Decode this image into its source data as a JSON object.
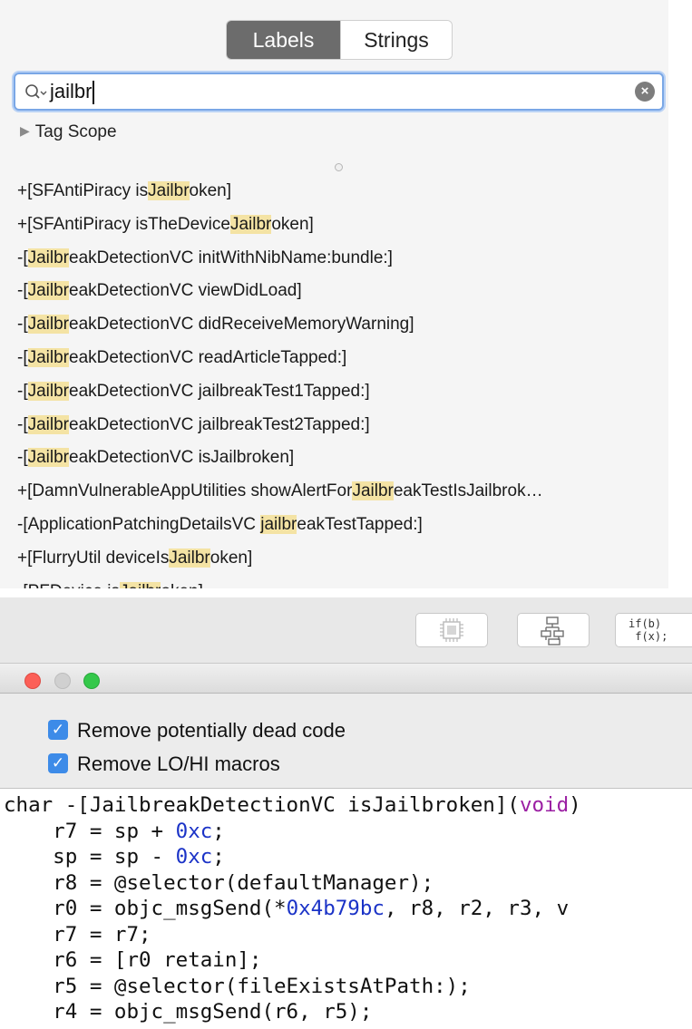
{
  "search_panel": {
    "tabs": [
      {
        "label": "Labels",
        "selected": true
      },
      {
        "label": "Strings",
        "selected": false
      }
    ],
    "search": {
      "prefix_icon": "search-icon",
      "value": "jailbr"
    },
    "tag_scope_label": "Tag Scope",
    "query_highlight": "jailbr",
    "results": [
      [
        "+[SFAntiPiracy is",
        {
          "h": "Jailbr"
        },
        "oken]"
      ],
      [
        "+[SFAntiPiracy isTheDevice",
        {
          "h": "Jailbr"
        },
        "oken]"
      ],
      [
        "-[",
        {
          "h": "Jailbr"
        },
        "eakDetectionVC initWithNibName:bundle:]"
      ],
      [
        "-[",
        {
          "h": "Jailbr"
        },
        "eakDetectionVC viewDidLoad]"
      ],
      [
        "-[",
        {
          "h": "Jailbr"
        },
        "eakDetectionVC didReceiveMemoryWarning]"
      ],
      [
        "-[",
        {
          "h": "Jailbr"
        },
        "eakDetectionVC readArticleTapped:]"
      ],
      [
        "-[",
        {
          "h": "Jailbr"
        },
        "eakDetectionVC jailbreakTest1Tapped:]"
      ],
      [
        "-[",
        {
          "h": "Jailbr"
        },
        "eakDetectionVC jailbreakTest2Tapped:]"
      ],
      [
        "-[",
        {
          "h": "Jailbr"
        },
        "eakDetectionVC isJailbroken]"
      ],
      [
        "+[DamnVulnerableAppUtilities showAlertFor",
        {
          "h": "Jailbr"
        },
        "eakTestIsJailbrok…"
      ],
      [
        "-[ApplicationPatchingDetailsVC ",
        {
          "h": "jailbr"
        },
        "eakTestTapped:]"
      ],
      [
        "+[FlurryUtil deviceIs",
        {
          "h": "Jailbr"
        },
        "oken]"
      ],
      [
        "-[PFDevice is",
        {
          "h": "Jailbr"
        },
        "oken]"
      ]
    ]
  },
  "decompiler": {
    "toolbar": {
      "buttons": [
        {
          "name": "chip-icon"
        },
        {
          "name": "flowchart-icon"
        },
        {
          "name": "pseudocode-button",
          "lines": [
            "if(b)",
            " f(x);"
          ]
        }
      ]
    },
    "options": [
      {
        "label": "Remove potentially dead code",
        "checked": true
      },
      {
        "label": "Remove LO/HI macros",
        "checked": true
      }
    ],
    "code_lines": [
      [
        {
          "t": "char -[JailbreakDetectionVC isJailbroken]("
        },
        {
          "t": "void",
          "c": "kw"
        },
        {
          "t": ")"
        }
      ],
      [
        {
          "t": "    r7 = sp + "
        },
        {
          "t": "0xc",
          "c": "num"
        },
        {
          "t": ";"
        }
      ],
      [
        {
          "t": "    sp = sp - "
        },
        {
          "t": "0xc",
          "c": "num"
        },
        {
          "t": ";"
        }
      ],
      [
        {
          "t": "    r8 = @selector(defaultManager);"
        }
      ],
      [
        {
          "t": "    r0 = objc_msgSend(*"
        },
        {
          "t": "0x4b79bc",
          "c": "num"
        },
        {
          "t": ", r8, r2, r3, v"
        }
      ],
      [
        {
          "t": "    r7 = r7;"
        }
      ],
      [
        {
          "t": "    r6 = [r0 retain];"
        }
      ],
      [
        {
          "t": "    r5 = @selector(fileExistsAtPath:);"
        }
      ],
      [
        {
          "t": "    r4 = objc_msgSend(r6, r5);"
        }
      ]
    ]
  },
  "colors": {
    "highlight": "#f4e3a4",
    "checkbox": "#3d8be8",
    "keyword": "#9b1fa3",
    "number": "#1b33c7",
    "close_light": "#fc5f57",
    "zoom_light": "#34c84a"
  }
}
